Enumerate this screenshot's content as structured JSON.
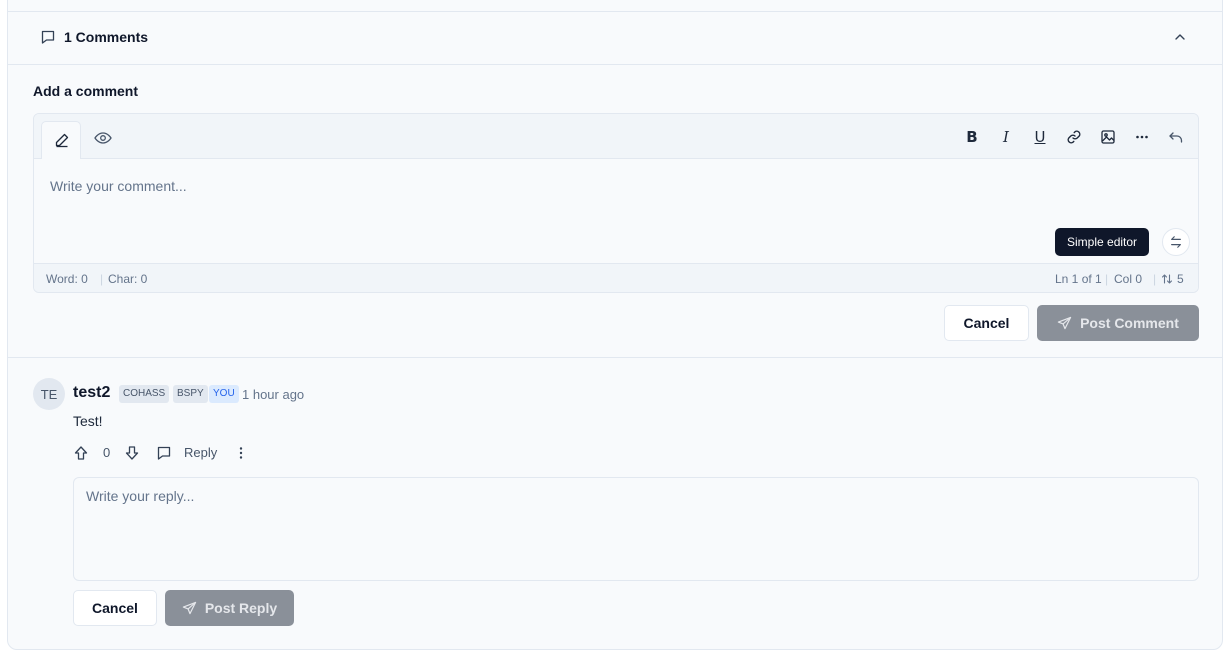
{
  "header": {
    "comment_count_label": "1 Comments"
  },
  "composer": {
    "section_label": "Add a comment",
    "placeholder": "Write your comment...",
    "toolbar": {
      "bold": "B",
      "italic": "I",
      "underline": "U"
    },
    "simple_editor_label": "Simple editor",
    "status": {
      "words": "Word: 0",
      "chars": "Char: 0",
      "line": "Ln 1 of 1",
      "col": "Col 0",
      "lines_total": "5"
    },
    "cancel_label": "Cancel",
    "post_label": "Post Comment"
  },
  "comment": {
    "avatar_initials": "TE",
    "author": "test2",
    "badges": [
      "COHASS",
      "BSPY",
      "YOU"
    ],
    "time": "1 hour ago",
    "body": "Test!",
    "votes": "0",
    "reply_label": "Reply"
  },
  "reply": {
    "placeholder": "Write your reply...",
    "cancel_label": "Cancel",
    "post_label": "Post Reply"
  },
  "colors": {
    "disabled_button": "#8a9099",
    "tooltip_bg": "#0f172a",
    "you_badge": "#dbeafe"
  }
}
